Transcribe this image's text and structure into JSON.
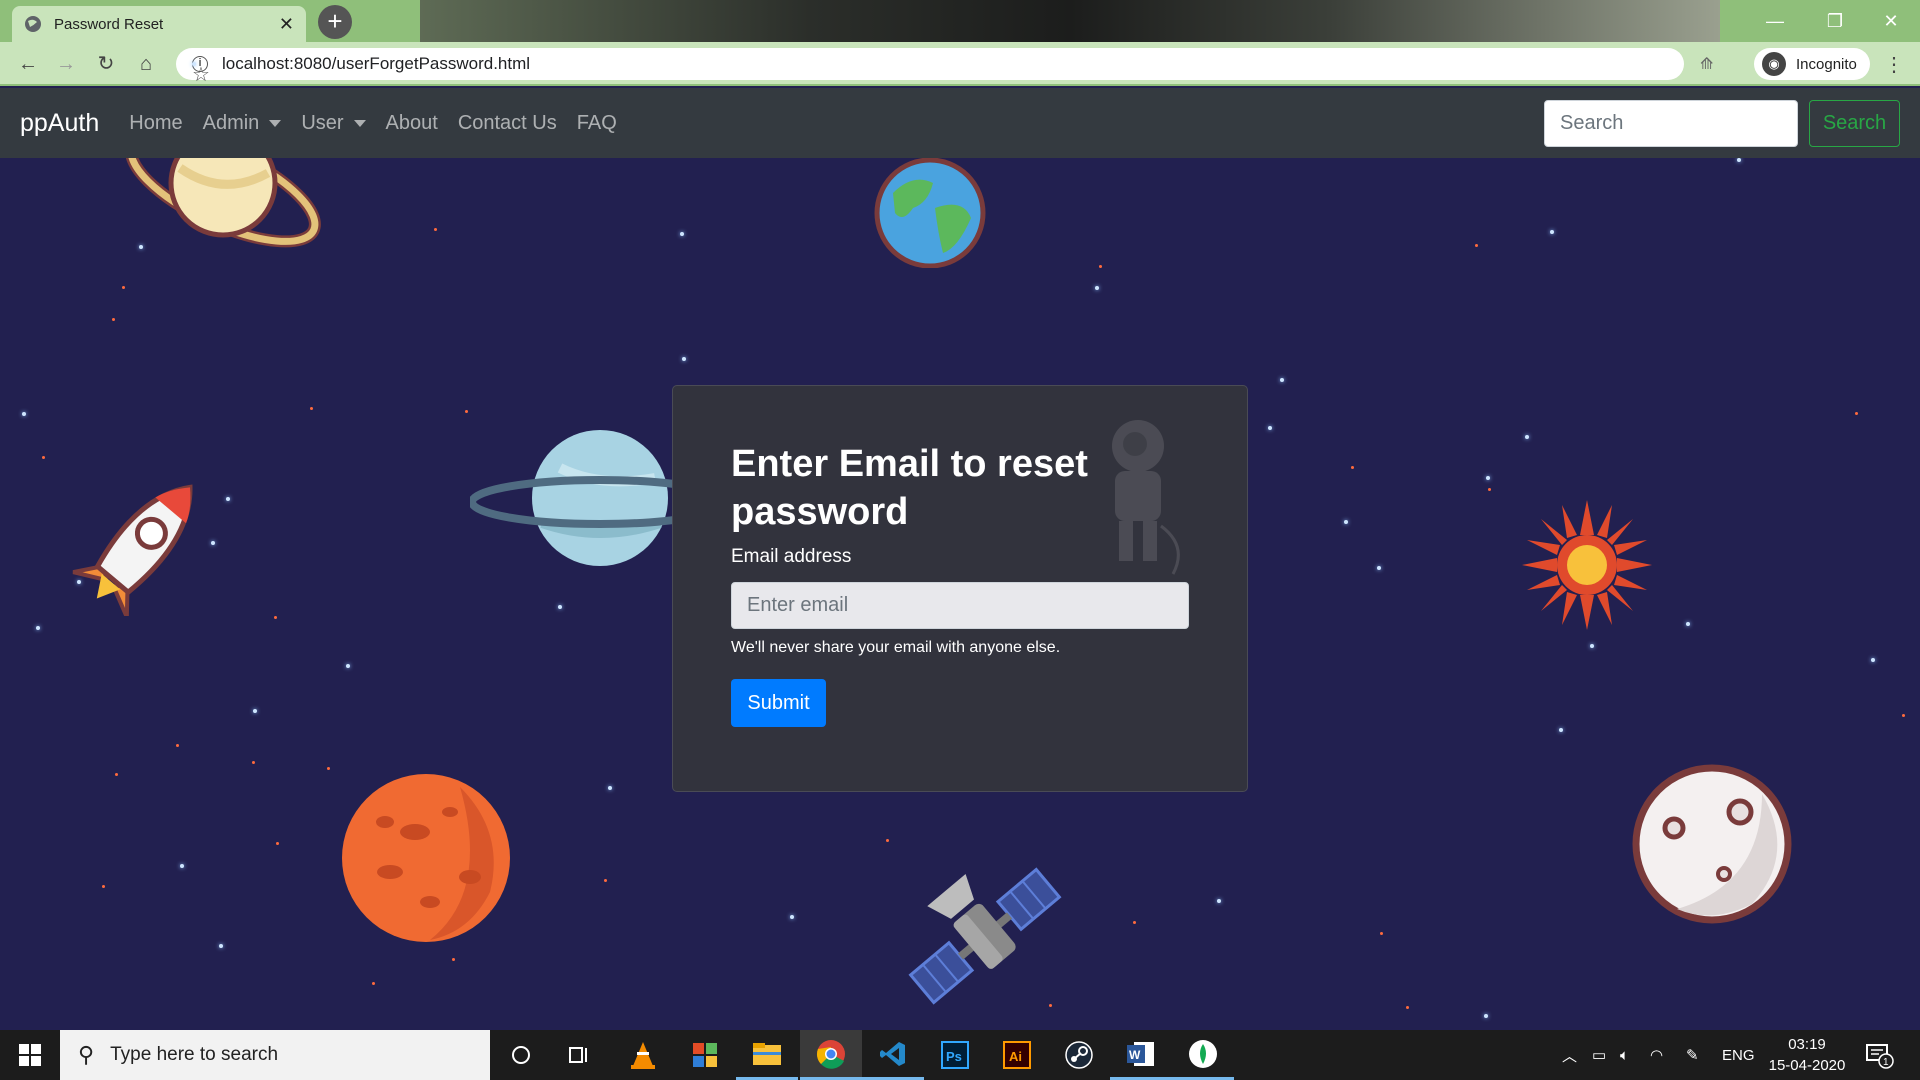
{
  "browser": {
    "tab_title": "Password Reset",
    "url": "localhost:8080/userForgetPassword.html",
    "profile_label": "Incognito"
  },
  "navbar": {
    "brand": "ppAuth",
    "links": [
      "Home",
      "Admin",
      "User",
      "About",
      "Contact Us",
      "FAQ"
    ],
    "search_placeholder": "Search",
    "search_button": "Search"
  },
  "form": {
    "title": "Enter Email to reset password",
    "email_label": "Email address",
    "email_placeholder": "Enter email",
    "email_help": "We'll never share your email with anyone else.",
    "submit_label": "Submit"
  },
  "taskbar": {
    "search_placeholder": "Type here to search",
    "language": "ENG",
    "time": "03:19",
    "date": "15-04-2020",
    "notification_count": "1",
    "apps": [
      "cortana-icon",
      "task-view-icon",
      "vlc-icon",
      "app-grid-icon",
      "file-explorer-icon",
      "chrome-icon",
      "vscode-icon",
      "photoshop-icon",
      "illustrator-icon",
      "steam-icon",
      "word-icon",
      "mongodb-icon"
    ]
  },
  "colors": {
    "space_bg": "#222050",
    "navbar_bg": "#343a40",
    "card_bg": "#32333d",
    "primary": "#007bff",
    "success": "#28a745",
    "chrome_theme": "#c9e4bb"
  }
}
